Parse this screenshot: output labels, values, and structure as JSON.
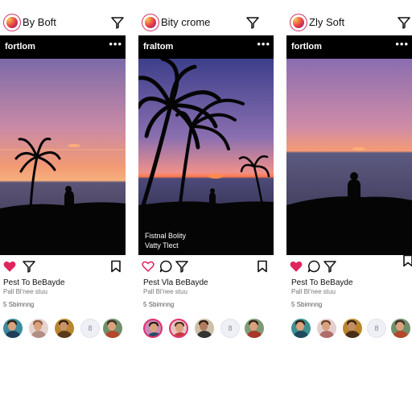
{
  "cards": [
    {
      "app_name": "By Boft",
      "post_user": "fortlom",
      "more_icon": "more-dots-icon",
      "post_title": "Pest To BeBayde",
      "post_subtitle": "Pall Bl'nee stuu",
      "post_count": "5 Sbimnng",
      "photo_caption_line1": "",
      "photo_caption_line2": "",
      "liked": true,
      "avatar_letter": "8"
    },
    {
      "app_name": "Bity crome",
      "post_user": "fraltom",
      "more_icon": "more-dots-icon",
      "post_title": "Pest Vla BeBayde",
      "post_subtitle": "Pall Bl'nee stuu",
      "post_count": "5 Sbimnng",
      "photo_caption_line1": "Fistnal Bolity",
      "photo_caption_line2": "Vatty Tlect",
      "liked": false,
      "avatar_letter": "8"
    },
    {
      "app_name": "Zly Soft",
      "post_user": "fortlom",
      "more_icon": "more-dots-icon",
      "post_title": "Pest To BeBayde",
      "post_subtitle": "Pall Bl'nee stuu",
      "post_count": "5 Sbimnng",
      "photo_caption_line1": "",
      "photo_caption_line2": "",
      "liked": true,
      "avatar_letter": "8"
    }
  ],
  "colors": {
    "like_red": "#e0245e",
    "sky_top": "#8c6fa8",
    "sky_mid": "#f5a07a",
    "sun": "#ff7a3d",
    "sea": "#4a4a6e"
  },
  "icons": [
    "app-logo-icon",
    "filter-icon",
    "heart-icon",
    "comment-icon",
    "send-icon",
    "bookmark-icon",
    "more-dots-icon"
  ]
}
